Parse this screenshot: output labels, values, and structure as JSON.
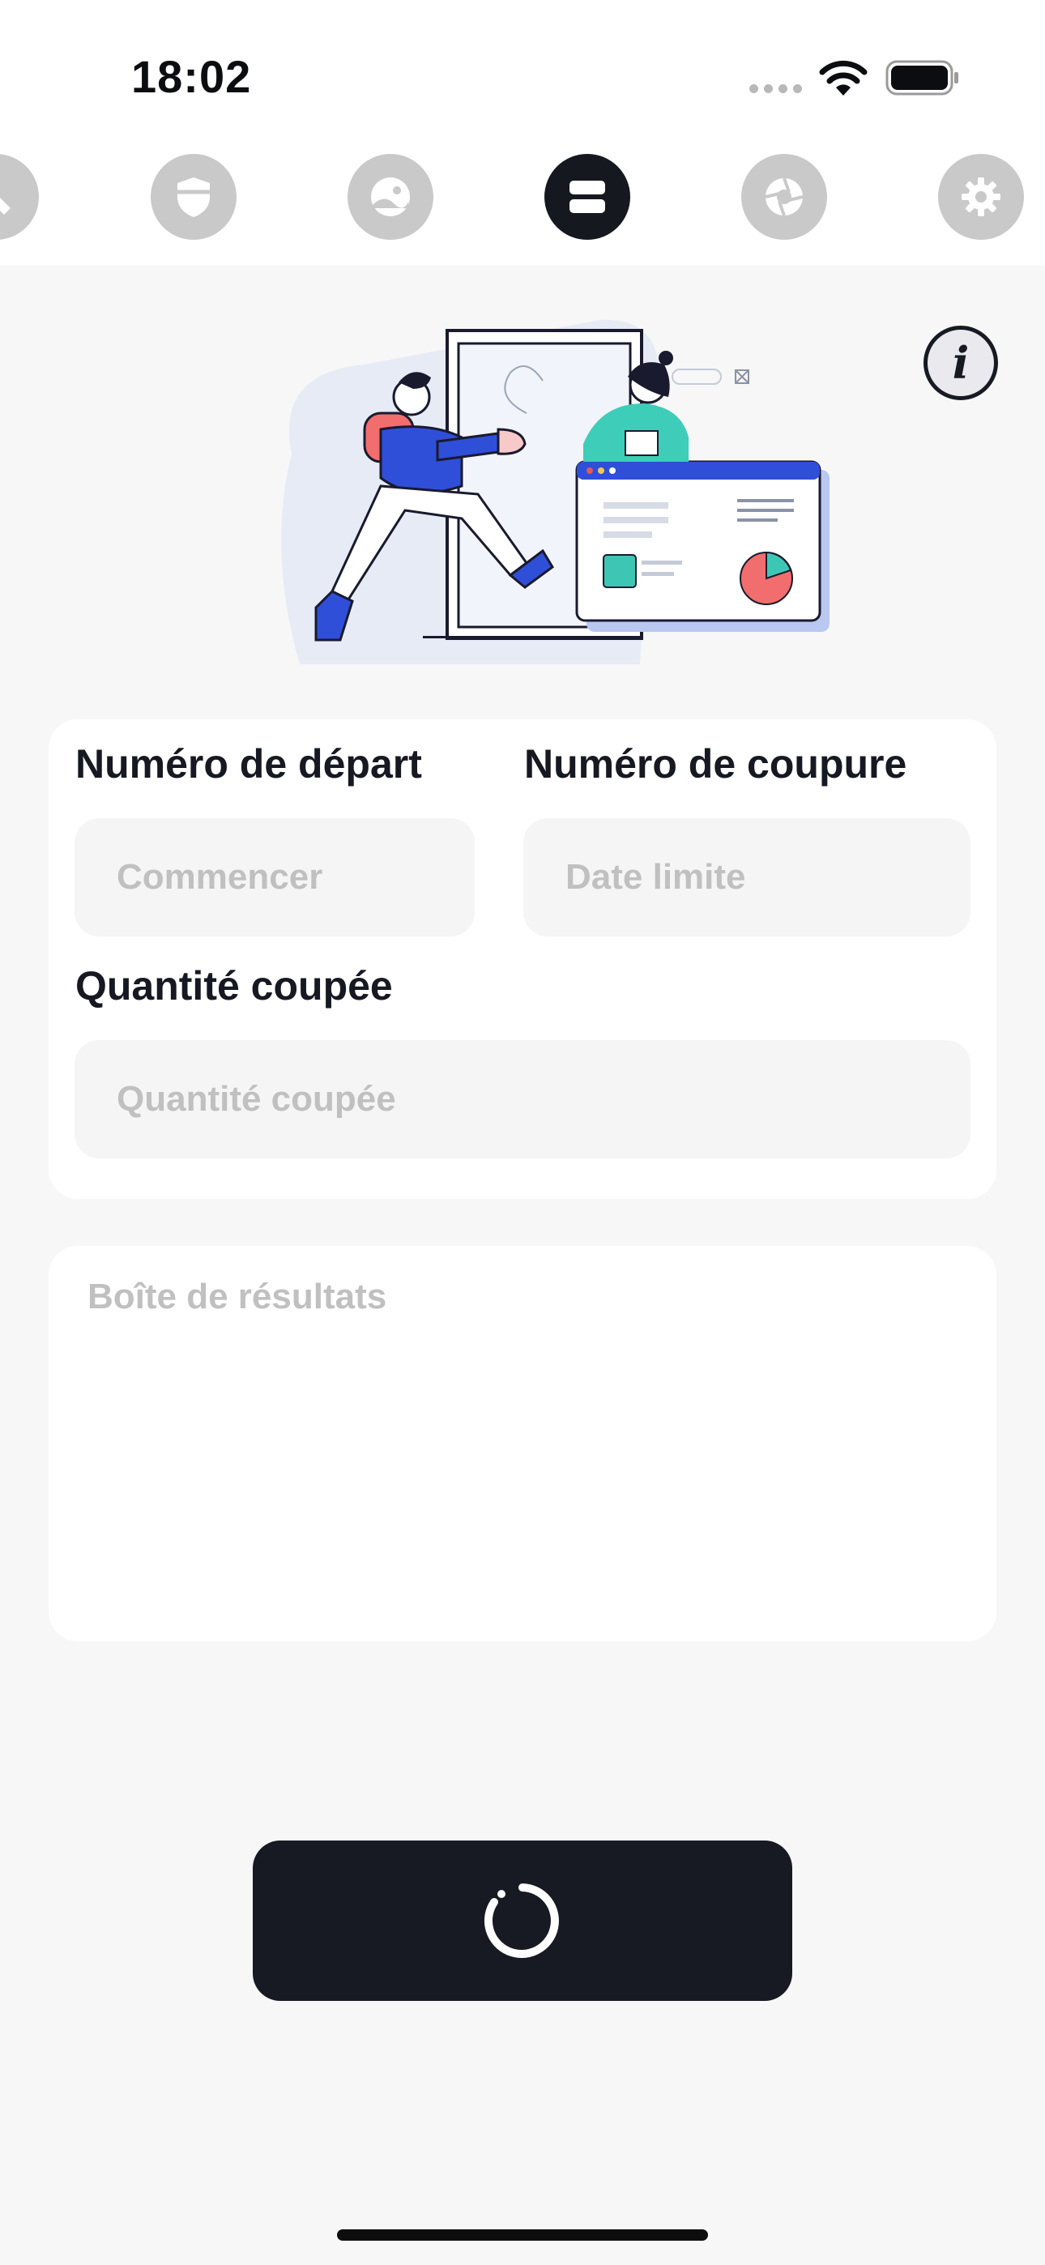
{
  "status_bar": {
    "time": "18:02"
  },
  "tabs": [
    {
      "icon": "tools-icon",
      "active": false
    },
    {
      "icon": "shield-icon",
      "active": false
    },
    {
      "icon": "landscape-icon",
      "active": false
    },
    {
      "icon": "stack-icon",
      "active": true
    },
    {
      "icon": "aperture-icon",
      "active": false
    },
    {
      "icon": "gear-icon",
      "active": false
    }
  ],
  "form": {
    "start_label": "Numéro de départ",
    "start_placeholder": "Commencer",
    "cutoff_label": "Numéro de coupure",
    "cutoff_placeholder": "Date limite",
    "quantity_label": "Quantité coupée",
    "quantity_placeholder": "Quantité coupée"
  },
  "result": {
    "placeholder": "Boîte de résultats"
  },
  "colors": {
    "dark": "#171a22",
    "background": "#f7f7f7",
    "inactive_tab": "#c9c9c9",
    "placeholder": "#c0c0c0"
  }
}
